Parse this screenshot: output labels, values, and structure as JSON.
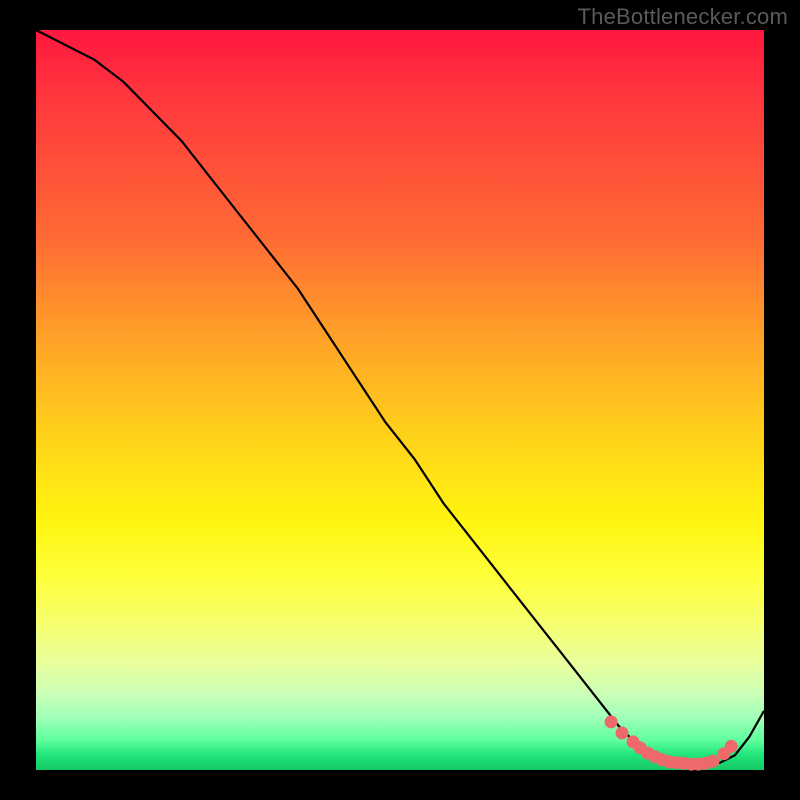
{
  "watermark": "TheBottlenecker.com",
  "chart_data": {
    "type": "line",
    "title": "",
    "xlabel": "",
    "ylabel": "",
    "xlim": [
      0,
      100
    ],
    "ylim": [
      0,
      100
    ],
    "curve": {
      "name": "bottleneck-curve",
      "x": [
        0,
        4,
        8,
        12,
        16,
        20,
        24,
        28,
        32,
        36,
        40,
        44,
        48,
        52,
        56,
        60,
        64,
        68,
        72,
        76,
        80,
        83,
        86,
        88,
        90,
        92,
        94,
        96,
        98,
        100
      ],
      "y": [
        100,
        98,
        96,
        93,
        89,
        85,
        80,
        75,
        70,
        65,
        59,
        53,
        47,
        42,
        36,
        31,
        26,
        21,
        16,
        11,
        6,
        3,
        1.5,
        1.0,
        0.8,
        0.8,
        1.0,
        2.0,
        4.5,
        8
      ]
    },
    "markers": {
      "name": "highlight-points",
      "x": [
        79,
        80.5,
        82,
        83,
        84,
        85,
        86,
        87,
        88,
        89,
        90,
        91,
        92,
        93,
        94.5,
        95.5
      ],
      "y": [
        6.5,
        5.0,
        3.8,
        3.0,
        2.3,
        1.8,
        1.4,
        1.1,
        1.0,
        0.9,
        0.8,
        0.8,
        0.9,
        1.2,
        2.2,
        3.2
      ]
    },
    "gradient_stops": [
      {
        "pos": 0,
        "color": "#ff173f"
      },
      {
        "pos": 55,
        "color": "#ffd21a"
      },
      {
        "pos": 74,
        "color": "#fdff3a"
      },
      {
        "pos": 100,
        "color": "#17c966"
      }
    ]
  },
  "colors": {
    "curve": "#000000",
    "marker": "#ee6a6a",
    "frame": "#000000"
  }
}
